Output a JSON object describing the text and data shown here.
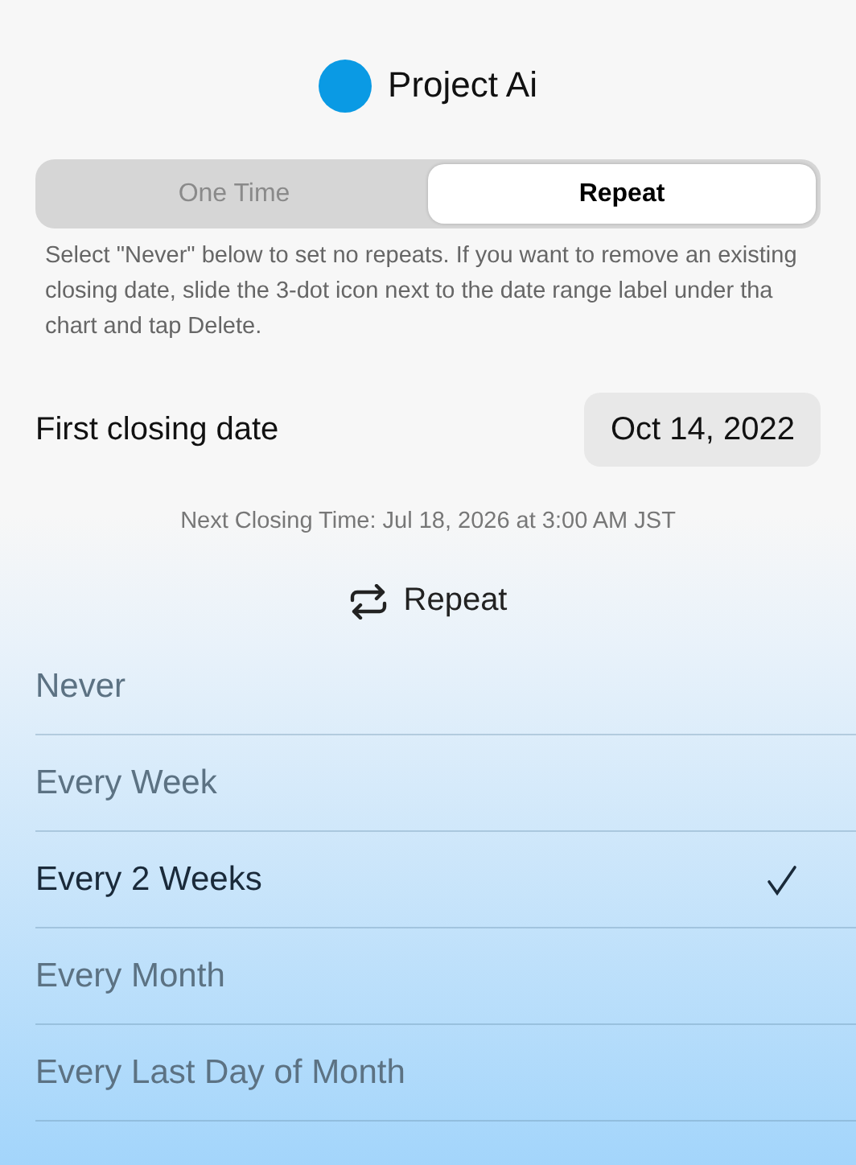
{
  "project": {
    "name": "Project Ai"
  },
  "mode_tabs": [
    {
      "label": "One Time",
      "selected": false
    },
    {
      "label": "Repeat",
      "selected": true
    }
  ],
  "help_text": "Select \"Never\" below to set no repeats. If you want to remove an existing closing date, slide the 3-dot icon next to the date range label under tha chart and tap Delete.",
  "first_closing": {
    "label": "First closing date",
    "value": "Oct 14, 2022"
  },
  "next_closing": "Next Closing Time: Jul 18, 2026 at 3:00 AM JST",
  "repeat_header": "Repeat",
  "repeat_options": [
    {
      "label": "Never",
      "selected": false
    },
    {
      "label": "Every Week",
      "selected": false
    },
    {
      "label": "Every 2 Weeks",
      "selected": true
    },
    {
      "label": "Every Month",
      "selected": false
    },
    {
      "label": "Every Last Day of Month",
      "selected": false
    }
  ]
}
